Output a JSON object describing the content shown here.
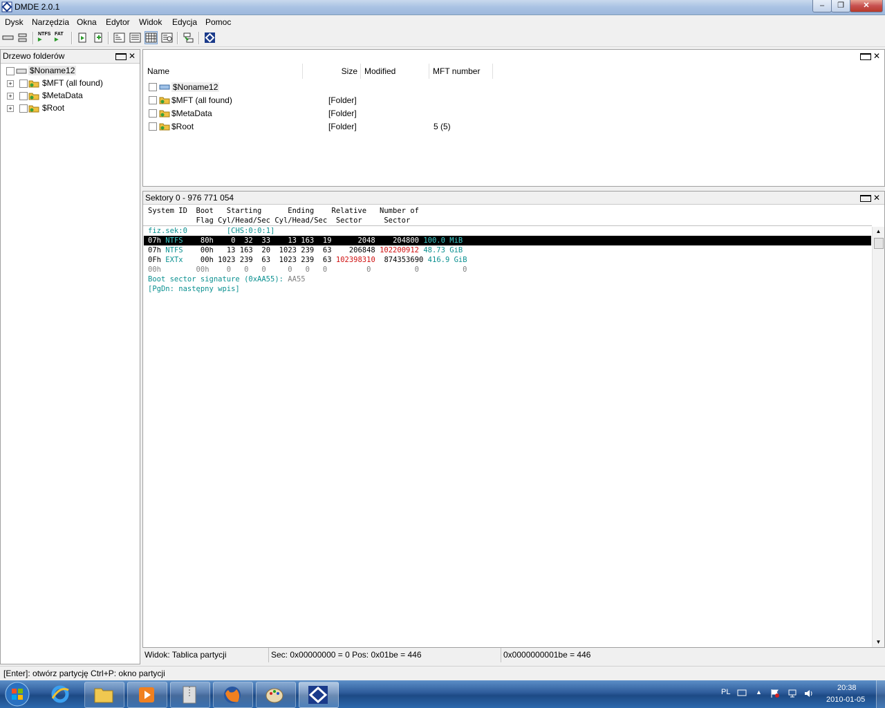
{
  "window": {
    "title": "DMDE 2.0.1"
  },
  "menu": [
    "Dysk",
    "Narzędzia",
    "Okna",
    "Edytor",
    "Widok",
    "Edycja",
    "Pomoc"
  ],
  "toolbar": {
    "ntfs_label": "NTFS",
    "fat_label": "FAT"
  },
  "tree_pane": {
    "title": "Drzewo folderów",
    "items": [
      {
        "label": "$Noname12"
      },
      {
        "label": "$MFT (all found)"
      },
      {
        "label": "$MetaData"
      },
      {
        "label": "$Root"
      }
    ]
  },
  "list_pane": {
    "columns": [
      "Name",
      "Size",
      "Modified",
      "MFT number"
    ],
    "rows": [
      {
        "name": "$Noname12",
        "size": "",
        "modified": "",
        "mft": ""
      },
      {
        "name": "$MFT (all found)",
        "size": "[Folder]",
        "modified": "",
        "mft": ""
      },
      {
        "name": "$MetaData",
        "size": "[Folder]",
        "modified": "",
        "mft": ""
      },
      {
        "name": "$Root",
        "size": "[Folder]",
        "modified": "",
        "mft": "5 (5)"
      }
    ]
  },
  "sector_pane": {
    "title": "Sektory 0 - 976 771 054",
    "header1": "System ID  Boot   Starting      Ending    Relative   Number of",
    "header2": "           Flag Cyl/Head/Sec Cyl/Head/Sec  Sector     Sector",
    "fiz": {
      "a": "fiz.sek:0",
      "b": "[CHS:0:0:1]"
    },
    "partitions": [
      {
        "id": "07h",
        "type": "NTFS",
        "rest": "80h    0  32  33    13 163  19      2048",
        "rel_red": "",
        "num": "204800",
        "size": "100.0 MiB",
        "size_color": "teal",
        "highlight": true
      },
      {
        "id": "07h",
        "type": "NTFS",
        "rest": "00h   13 163  20  1023 239  63    206848",
        "rel_red": "",
        "num_red": "102200912",
        "size": "48.73 GiB",
        "size_color": "teal"
      },
      {
        "id": "0Fh",
        "type": "EXTx",
        "rest": "00h 1023 239  63  1023 239  63",
        "rel_red": "102398310",
        "num": "874353690",
        "size": "416.9 GiB",
        "size_color": "teal"
      },
      {
        "id": "00h",
        "type": "",
        "rest": "00h    0   0   0     0   0   0         0          0          0",
        "gray": true
      }
    ],
    "signature_label": "Boot sector signature (0xAA55):",
    "signature_value": "AA55",
    "pgdn": "[PgDn: następny wpis]"
  },
  "status": {
    "view": "Widok: Tablica partycji",
    "sec": "Sec: 0x00000000 = 0  Pos: 0x01be = 446",
    "offset": "0x0000000001be = 446"
  },
  "hint": "[Enter]: otwórz partycję  Ctrl+P: okno partycji",
  "tray": {
    "lang": "PL",
    "time": "20:38",
    "date": "2010-01-05"
  },
  "colors": {
    "teal": "#0a9090",
    "red": "#d01010",
    "highlight_bg": "#000000"
  }
}
